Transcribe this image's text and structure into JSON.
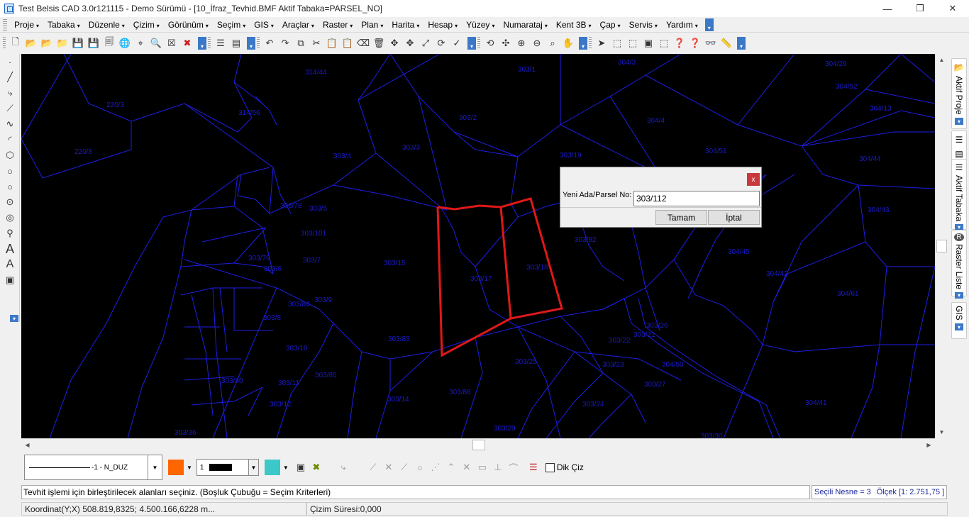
{
  "window": {
    "title": "Test Belsis CAD 3.0r121115 - Demo Sürümü - [10_İfraz_Tevhid.BMF  Aktif Tabaka=PARSEL_NO]",
    "minimize": "—",
    "restore": "❐",
    "close": "✕"
  },
  "menu": [
    {
      "label": "Proje"
    },
    {
      "label": "Tabaka"
    },
    {
      "label": "Düzenle"
    },
    {
      "label": "Çizim"
    },
    {
      "label": "Görünüm"
    },
    {
      "label": "Seçim"
    },
    {
      "label": "GIS"
    },
    {
      "label": "Araçlar"
    },
    {
      "label": "Raster"
    },
    {
      "label": "Plan"
    },
    {
      "label": "Harita"
    },
    {
      "label": "Hesap"
    },
    {
      "label": "Yüzey"
    },
    {
      "label": "Numarataj"
    },
    {
      "label": "Kent 3B"
    },
    {
      "label": "Çap"
    },
    {
      "label": "Servis"
    },
    {
      "label": "Yardım"
    }
  ],
  "parcels": [
    {
      "label": "314/44"
    },
    {
      "label": "303/1"
    },
    {
      "label": "304/3"
    },
    {
      "label": "304/26"
    },
    {
      "label": "220/3"
    },
    {
      "label": "314/56"
    },
    {
      "label": "304/52"
    },
    {
      "label": "304/13"
    },
    {
      "label": "303/2"
    },
    {
      "label": "304/4"
    },
    {
      "label": "220/8"
    },
    {
      "label": "303/3"
    },
    {
      "label": "303/4"
    },
    {
      "label": "303/19"
    },
    {
      "label": "304/51"
    },
    {
      "label": "304/44"
    },
    {
      "label": "303/78"
    },
    {
      "label": "303/5"
    },
    {
      "label": "304/43"
    },
    {
      "label": "303/101"
    },
    {
      "label": "303/82"
    },
    {
      "label": "303/79"
    },
    {
      "label": "303/7"
    },
    {
      "label": "303/15"
    },
    {
      "label": "303/18"
    },
    {
      "label": "304/45"
    },
    {
      "label": "303/6"
    },
    {
      "label": "303/17"
    },
    {
      "label": "304/42"
    },
    {
      "label": "304/61"
    },
    {
      "label": "303/84"
    },
    {
      "label": "303/9"
    },
    {
      "label": "303/8"
    },
    {
      "label": "303/26"
    },
    {
      "label": "303/21"
    },
    {
      "label": "303/83"
    },
    {
      "label": "303/22"
    },
    {
      "label": "303/10"
    },
    {
      "label": "303/25"
    },
    {
      "label": "303/23"
    },
    {
      "label": "304/50"
    },
    {
      "label": "303/85"
    },
    {
      "label": "303/80"
    },
    {
      "label": "303/11"
    },
    {
      "label": "303/27"
    },
    {
      "label": "303/88"
    },
    {
      "label": "303/14"
    },
    {
      "label": "303/24"
    },
    {
      "label": "304/41"
    },
    {
      "label": "303/12"
    },
    {
      "label": "303/36"
    },
    {
      "label": "303/29"
    },
    {
      "label": "303/30"
    }
  ],
  "right_panel": {
    "tabs": [
      {
        "label": "Aktif Proje"
      },
      {
        "label": "Aktif Tabaka"
      },
      {
        "label": "Raster Liste"
      },
      {
        "label": "GIS"
      }
    ]
  },
  "bottom": {
    "line_style": "-1 - N_DUZ",
    "line_weight": "1",
    "dik_ciz_label": "Dik Çiz",
    "colors": {
      "primary": "#ff6600",
      "secondary": "#3cc8c8"
    }
  },
  "command_line": "Tevhit işlemi için birleştirilecek alanları seçiniz. (Boşluk Çubuğu = Seçim Kriterleri)",
  "info": {
    "selected": "Seçili Nesne = 3",
    "scale": "Ölçek [1: 2.751,75 ]"
  },
  "status": {
    "coord": "Koordinat(Y;X)  508.819,8325; 4.500.166,6228 m...",
    "draw_time": "Çizim Süresi:0,000"
  },
  "dialog": {
    "close": "x",
    "label": "Yeni Ada/Parsel No:",
    "value": "303/112",
    "ok": "Tamam",
    "cancel": "İptal"
  },
  "colors": {
    "canvas_bg": "#000000",
    "parcel_line": "#1e1ee6",
    "parcel_text": "#1a1ac8",
    "selection": "#e01818"
  }
}
